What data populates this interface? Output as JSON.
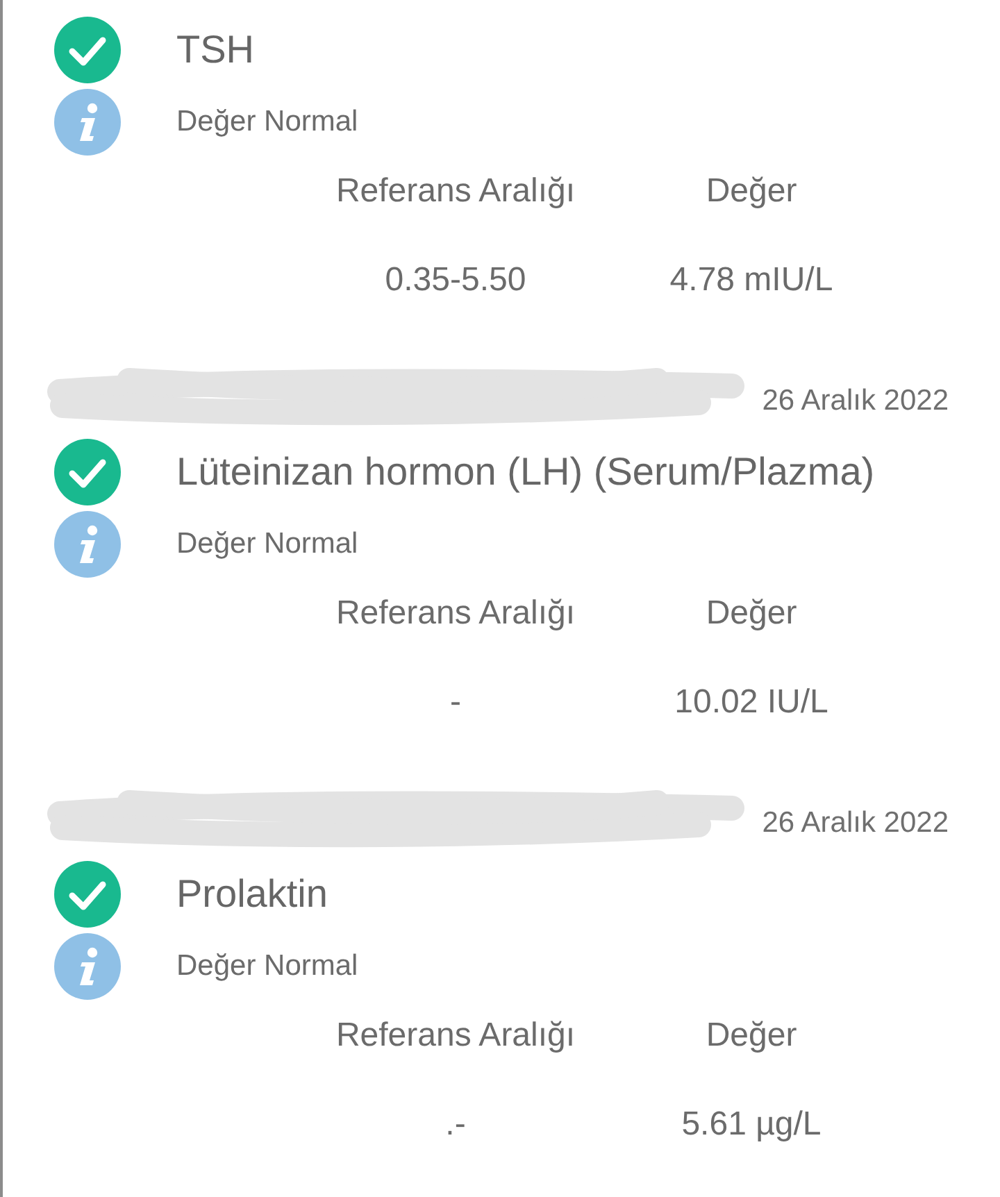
{
  "results": [
    {
      "normal": true,
      "name": "TSH",
      "note": "Değer Normal",
      "reference_header": "Referans Aralığı",
      "value_header": "Değer",
      "reference": "0.35-5.50",
      "value": "4.78 mIU/L"
    },
    {
      "date": "26 Aralık 2022",
      "redacted": true,
      "normal": true,
      "name": "Lüteinizan hormon (LH) (Serum/Plazma)",
      "note": "Değer Normal",
      "reference_header": "Referans Aralığı",
      "value_header": "Değer",
      "reference": "-",
      "value": "10.02 IU/L"
    },
    {
      "date": "26 Aralık 2022",
      "redacted": true,
      "normal": true,
      "name": "Prolaktin",
      "note": "Değer Normal",
      "reference_header": "Referans Aralığı",
      "value_header": "Değer",
      "reference": ".-",
      "value": "5.61 µg/L"
    }
  ]
}
